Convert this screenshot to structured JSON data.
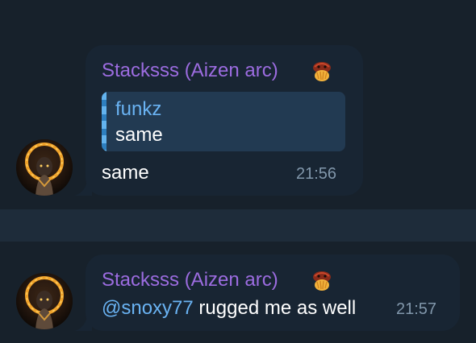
{
  "messages": [
    {
      "sender": "Stacksss (Aizen arc)",
      "badge_icon": "fox-hands-emoji-icon",
      "reply": {
        "name": "funkz",
        "text": "same"
      },
      "text": "same",
      "time": "21:56"
    },
    {
      "sender": "Stacksss (Aizen arc)",
      "badge_icon": "fox-hands-emoji-icon",
      "mention": "@snoxy77",
      "text": " rugged me as well",
      "time": "21:57"
    }
  ],
  "colors": {
    "background": "#17212b",
    "bubble": "#182533",
    "sender": "#9c6ce0",
    "mention": "#6ab3f3",
    "time": "#8197ab"
  }
}
